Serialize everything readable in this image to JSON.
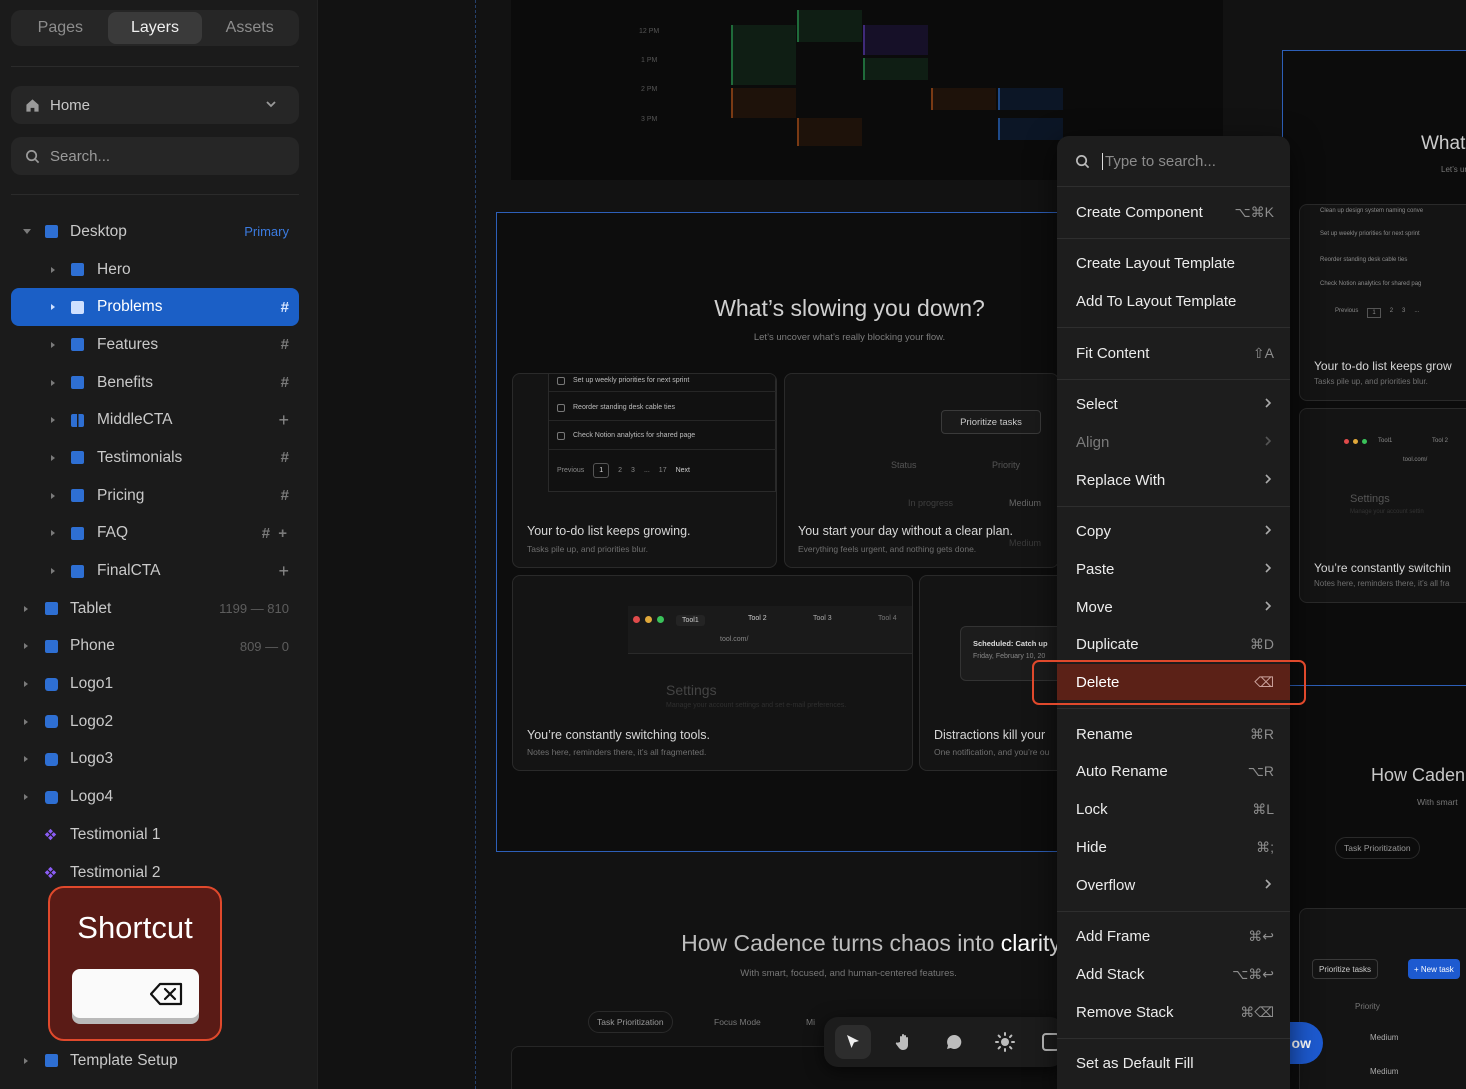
{
  "left_panel": {
    "tabs": [
      {
        "label": "Pages",
        "active": false
      },
      {
        "label": "Layers",
        "active": true
      },
      {
        "label": "Assets",
        "active": false
      }
    ],
    "page_selector": {
      "label": "Home"
    },
    "search": {
      "placeholder": "Search..."
    },
    "layers": [
      {
        "label": "Desktop",
        "indent": 0,
        "icon": "stack-icon",
        "badge": "Primary"
      },
      {
        "label": "Hero",
        "indent": 1,
        "icon": "stack-icon"
      },
      {
        "label": "Problems",
        "indent": 1,
        "icon": "stack-icon",
        "selected": true,
        "marker": "#"
      },
      {
        "label": "Features",
        "indent": 1,
        "icon": "stack-icon",
        "marker": "#"
      },
      {
        "label": "Benefits",
        "indent": 1,
        "icon": "stack-icon",
        "marker": "#"
      },
      {
        "label": "MiddleCTA",
        "indent": 1,
        "icon": "columns-icon",
        "marker": "+"
      },
      {
        "label": "Testimonials",
        "indent": 1,
        "icon": "stack-icon",
        "marker": "#"
      },
      {
        "label": "Pricing",
        "indent": 1,
        "icon": "stack-icon",
        "marker": "#"
      },
      {
        "label": "FAQ",
        "indent": 1,
        "icon": "stack-icon",
        "marker": "# +"
      },
      {
        "label": "FinalCTA",
        "indent": 1,
        "icon": "stack-icon",
        "marker": "+"
      },
      {
        "label": "Tablet",
        "indent": 0,
        "icon": "stack-icon",
        "meta": "1199 — 810"
      },
      {
        "label": "Phone",
        "indent": 0,
        "icon": "stack-icon",
        "meta": "809 — 0"
      },
      {
        "label": "Logo1",
        "indent": 0,
        "icon": "frame-icon"
      },
      {
        "label": "Logo2",
        "indent": 0,
        "icon": "frame-icon"
      },
      {
        "label": "Logo3",
        "indent": 0,
        "icon": "frame-icon"
      },
      {
        "label": "Logo4",
        "indent": 0,
        "icon": "frame-icon"
      },
      {
        "label": "Testimonial 1",
        "indent": 0,
        "icon": "component-icon"
      },
      {
        "label": "Testimonial 2",
        "indent": 0,
        "icon": "component-icon"
      },
      {
        "label": "Template Setup",
        "indent": 0,
        "icon": "stack-icon"
      }
    ]
  },
  "shortcut_overlay": {
    "title": "Shortcut",
    "key_icon": "backspace-icon"
  },
  "canvas": {
    "section1": {
      "title": "What’s slowing you down?",
      "subtitle": "Let’s uncover what’s really blocking your flow."
    },
    "cards": [
      {
        "title": "Your to-do list keeps growing.",
        "subtitle": "Tasks pile up, and priorities blur."
      },
      {
        "title": "You start your day without a clear plan.",
        "subtitle": "Everything feels urgent, and nothing gets done."
      },
      {
        "title": "You’re constantly switching tools.",
        "subtitle": "Notes here, reminders there, it’s all fragmented."
      },
      {
        "title": "Distractions kill your",
        "subtitle": "One notification, and you’re ou"
      }
    ],
    "todo_items": [
      "Set up weekly priorities for next sprint",
      "Reorder standing desk cable ties",
      "Check Notion analytics for shared page"
    ],
    "pagination": [
      "Previous",
      "1",
      "2",
      "3",
      "...",
      "17",
      "Next"
    ],
    "prioritize_button": "Prioritize tasks",
    "table_headers": [
      "Status",
      "Priority"
    ],
    "table_row": [
      "In progress",
      "Medium",
      "Medium"
    ],
    "browser_tabs": [
      "Tool1",
      "Tool 2",
      "Tool 3",
      "Tool 4"
    ],
    "url": "tool.com/",
    "settings_title": "Settings",
    "settings_sub": "Manage your account settings and set e-mail preferences.",
    "scheduled": {
      "title": "Scheduled: Catch up",
      "date": "Friday, February 10, 20"
    },
    "section2": {
      "title_a": "How Cadence turns chaos into ",
      "title_b": "clarity",
      "subtitle": "With smart, focused, and human-centered features."
    },
    "feature_tabs": [
      "Task Prioritization",
      "Focus Mode",
      "Mi"
    ],
    "right_frame": {
      "title": "What",
      "subtitle": "Let’s un",
      "todo_items": [
        "Clean up design system naming conve",
        "Set up weekly priorities for next sprint",
        "Reorder standing desk cable ties",
        "Check Notion analytics for shared pag"
      ],
      "pagination": [
        "Previous",
        "1",
        "2",
        "3",
        "..."
      ],
      "card1": {
        "title": "Your to-do list keeps grow",
        "subtitle": "Tasks pile up, and priorities blur."
      },
      "browser_tabs": [
        "Tool1",
        "Tool 2"
      ],
      "url": "tool.com/",
      "settings": "Settings",
      "settings_sub": "Manage your account settin",
      "card2": {
        "title": "You’re constantly switchin",
        "subtitle": "Notes here, reminders there, it’s all fra"
      },
      "section2_title": "How Caden",
      "section2_sub": "With smart",
      "feature_tab": "Task Prioritization",
      "prioritize_button": "Prioritize tasks",
      "new_task": "+ New task",
      "priority_header": "Priority",
      "rows": [
        "Medium",
        "Medium"
      ]
    },
    "calendar_times": [
      "12 PM",
      "1 PM",
      "2 PM",
      "3 PM"
    ],
    "toolbar": [
      {
        "icon": "pointer-icon",
        "active": true
      },
      {
        "icon": "hand-icon"
      },
      {
        "icon": "comment-icon"
      },
      {
        "icon": "sun-icon"
      },
      {
        "icon": "component-icon"
      }
    ],
    "cta_fragment": "ow"
  },
  "context_menu": {
    "search_placeholder": "Type to search...",
    "groups": [
      [
        {
          "label": "Create Component",
          "shortcut": "⌥⌘K"
        }
      ],
      [
        {
          "label": "Create Layout Template"
        },
        {
          "label": "Add To Layout Template"
        }
      ],
      [
        {
          "label": "Fit Content",
          "shortcut": "⇧A"
        }
      ],
      [
        {
          "label": "Select",
          "submenu": true
        },
        {
          "label": "Align",
          "submenu": true,
          "disabled": true
        },
        {
          "label": "Replace With",
          "submenu": true
        }
      ],
      [
        {
          "label": "Copy",
          "submenu": true
        },
        {
          "label": "Paste",
          "submenu": true
        },
        {
          "label": "Move",
          "submenu": true
        },
        {
          "label": "Duplicate",
          "shortcut": "⌘D"
        },
        {
          "label": "Delete",
          "shortcut": "⌫",
          "highlighted": true
        }
      ],
      [
        {
          "label": "Rename",
          "shortcut": "⌘R"
        },
        {
          "label": "Auto Rename",
          "shortcut": "⌥R"
        },
        {
          "label": "Lock",
          "shortcut": "⌘L"
        },
        {
          "label": "Hide",
          "shortcut": "⌘;"
        },
        {
          "label": "Overflow",
          "submenu": true
        }
      ],
      [
        {
          "label": "Add Frame",
          "shortcut": "⌘↩"
        },
        {
          "label": "Add Stack",
          "shortcut": "⌥⌘↩"
        },
        {
          "label": "Remove Stack",
          "shortcut": "⌘⌫"
        }
      ],
      [
        {
          "label": "Set as Default Fill"
        }
      ]
    ]
  },
  "colors": {
    "accent": "#1b5fc6",
    "danger": "#e0492c",
    "component": "#8b5cf6",
    "frame_outline": "#2d5fb8"
  }
}
